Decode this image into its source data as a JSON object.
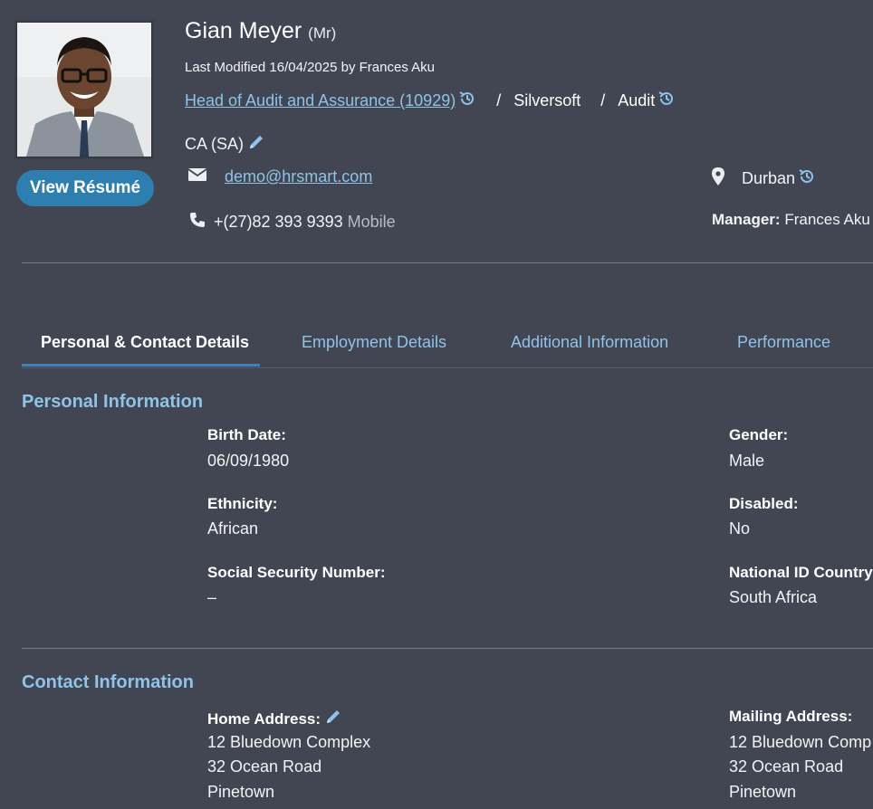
{
  "profile": {
    "name": "Gian Meyer",
    "title": "(Mr)",
    "last_modified": "Last Modified 16/04/2025 by Frances Aku",
    "position_link": "Head of Audit and Assurance (10929)",
    "company": "Silversoft",
    "department": "Audit",
    "breadcrumb_separator": "/",
    "qualification": "CA (SA)",
    "email": "demo@hrsmart.com",
    "phone": "+(27)82 393 9393",
    "phone_type": "Mobile",
    "location": "Durban",
    "manager_label": "Manager:",
    "manager_name": "Frances Aku",
    "view_resume_label": "View Résumé"
  },
  "tabs": [
    {
      "label": "Personal & Contact Details",
      "active": true
    },
    {
      "label": "Employment Details",
      "active": false
    },
    {
      "label": "Additional Information",
      "active": false
    },
    {
      "label": "Performance",
      "active": false
    }
  ],
  "personal": {
    "heading": "Personal Information",
    "birth_date_label": "Birth Date:",
    "birth_date": "06/09/1980",
    "gender_label": "Gender:",
    "gender": "Male",
    "ethnicity_label": "Ethnicity:",
    "ethnicity": "African",
    "disabled_label": "Disabled:",
    "disabled": "No",
    "ssn_label": "Social Security Number:",
    "ssn": "–",
    "national_id_country_label": "National ID Country",
    "national_id_country": "South Africa"
  },
  "contact": {
    "heading": "Contact Information",
    "home_label": "Home Address:",
    "home_lines": [
      "12 Bluedown Complex",
      "32 Ocean Road",
      "Pinetown"
    ],
    "mailing_label": "Mailing Address:",
    "mailing_lines": [
      "12 Bluedown Comp",
      "32 Ocean Road",
      "Pinetown"
    ]
  },
  "colors": {
    "background": "#414652",
    "accent_link": "#8fc3e8",
    "button": "#2e7fb0"
  },
  "icons": [
    "history-icon",
    "pencil-icon",
    "envelope-icon",
    "phone-icon",
    "map-pin-icon"
  ]
}
